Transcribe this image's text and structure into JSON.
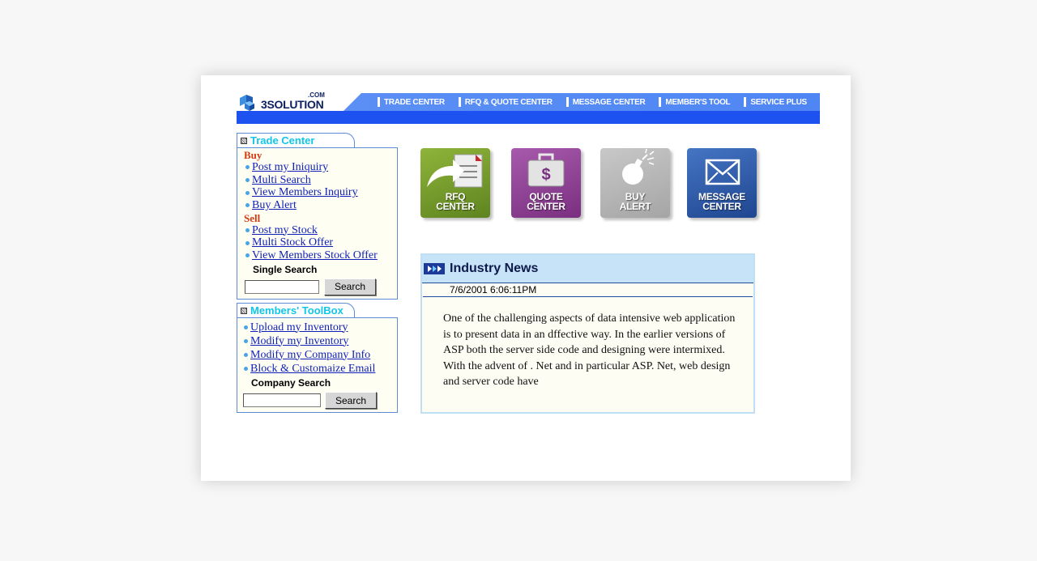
{
  "logo": {
    "text": "3SOLUTION",
    "com": ".COM"
  },
  "nav": [
    {
      "label": "TRADE CENTER"
    },
    {
      "label": "RFQ & QUOTE CENTER"
    },
    {
      "label": "MESSAGE CENTER"
    },
    {
      "label": "MEMBER'S TOOL"
    },
    {
      "label": "SERVICE PLUS"
    }
  ],
  "trade_center": {
    "title": "Trade Center",
    "buy_label": "Buy",
    "buy_links": [
      "Post my Iniquiry",
      "Multi Search",
      "View Members Inquiry",
      "Buy Alert"
    ],
    "sell_label": "Sell",
    "sell_links": [
      "Post my Stock",
      "Multi Stock Offer",
      "View Members Stock Offer"
    ],
    "search_label": "Single Search",
    "search_value": "",
    "search_button": "Search"
  },
  "toolbox": {
    "title": "Members' ToolBox",
    "links": [
      "Upload my Inventory",
      "Modify my Inventory",
      "Modify my Company Info",
      "Block & Customaize Email"
    ],
    "search_label": "Company Search",
    "search_value": "",
    "search_button": "Search"
  },
  "icons": [
    {
      "line1": "RFQ",
      "line2": "CENTER",
      "color": "#6f9424"
    },
    {
      "line1": "QUOTE",
      "line2": "CENTER",
      "color": "#8e3f93"
    },
    {
      "line1": "BUY",
      "line2": "ALERT",
      "color": "#b3b3b3"
    },
    {
      "line1": "MESSAGE",
      "line2": "CENTER",
      "color": "#2d58a8"
    }
  ],
  "news": {
    "title": "Industry News",
    "date": "7/6/2001 6:06:11PM",
    "body": "One of the challenging aspects of data intensive web application\n is to present data in an dffective way. In the earlier versions of\nASP both the server side code and designing were intermixed.\nWith the advent of . Net and in particular ASP. Net, web design\nand server code have"
  },
  "colors": {
    "nav_blue": "#4f86f4",
    "bar_blue": "#1e52f0",
    "panel_title": "#11c6e8",
    "section_red": "#d33c12",
    "link_blue": "#0f1fb8"
  }
}
